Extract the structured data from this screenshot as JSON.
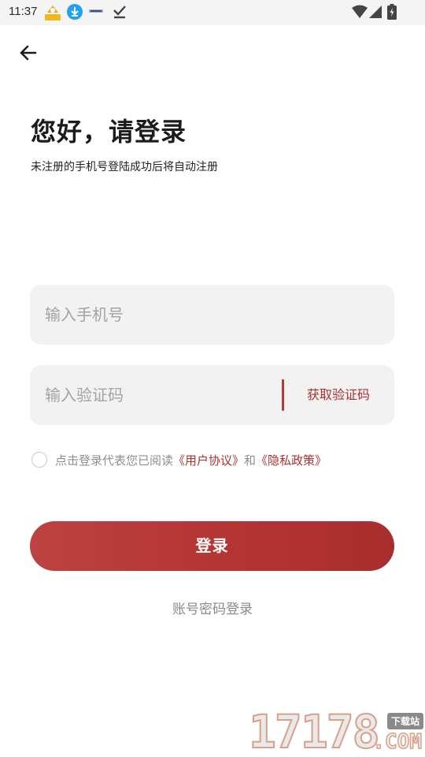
{
  "status_bar": {
    "time": "11:37",
    "icons": [
      "app-badge-icon",
      "download-icon",
      "news-icon",
      "check-icon",
      "wifi-icon",
      "signal-icon",
      "battery-icon"
    ]
  },
  "header": {
    "back_icon": "arrow-left-icon"
  },
  "login": {
    "title": "您好，请登录",
    "subtitle": "未注册的手机号登陆成功后将自动注册",
    "phone_placeholder": "输入手机号",
    "phone_value": "",
    "code_placeholder": "输入验证码",
    "code_value": "",
    "get_code_label": "获取验证码",
    "agreement": {
      "checked": false,
      "prefix": "点击登录代表您已阅读",
      "terms_link": "《用户协议》",
      "conjunction": "和",
      "privacy_link": "《隐私政策》"
    },
    "login_button": "登录",
    "account_login_link": "账号密码登录"
  },
  "watermark": {
    "number": "17178",
    "tag": "下载站",
    "domain": ".COM"
  },
  "colors": {
    "accent": "#B23A3A",
    "link": "#A93131",
    "field_bg": "#F2F2F2",
    "placeholder": "#A3A3A3",
    "muted_text": "#8E8E8E"
  }
}
